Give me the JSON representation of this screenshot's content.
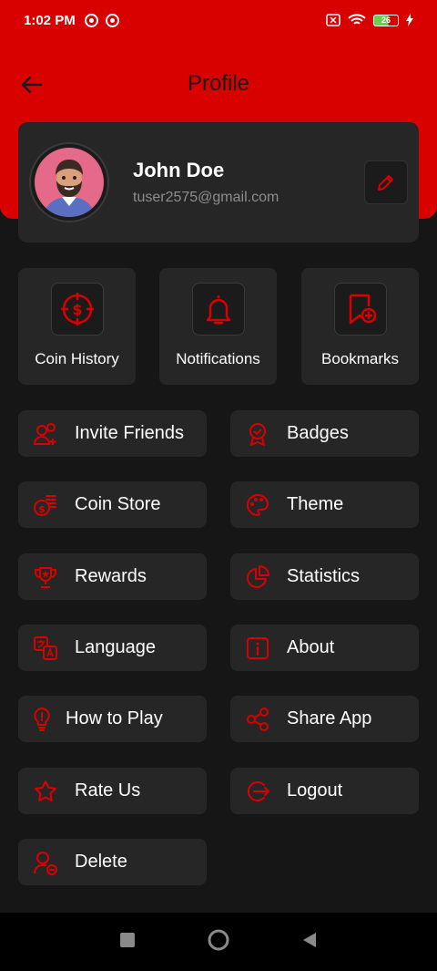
{
  "status_bar": {
    "time": "1:02 PM",
    "battery": "26"
  },
  "header": {
    "title": "Profile"
  },
  "profile": {
    "name": "John Doe",
    "email": "tuser2575@gmail.com"
  },
  "tiles": [
    {
      "label": "Coin History",
      "icon": "coin-history-icon"
    },
    {
      "label": "Notifications",
      "icon": "bell-icon"
    },
    {
      "label": "Bookmarks",
      "icon": "bookmark-add-icon"
    }
  ],
  "menu": [
    {
      "label": "Invite Friends",
      "icon": "invite-friends-icon"
    },
    {
      "label": "Badges",
      "icon": "badge-icon"
    },
    {
      "label": "Coin Store",
      "icon": "coin-store-icon"
    },
    {
      "label": "Theme",
      "icon": "palette-icon"
    },
    {
      "label": "Rewards",
      "icon": "trophy-icon"
    },
    {
      "label": "Statistics",
      "icon": "pie-chart-icon"
    },
    {
      "label": "Language",
      "icon": "translate-icon"
    },
    {
      "label": "About",
      "icon": "info-icon"
    },
    {
      "label": "How to Play",
      "icon": "lightbulb-icon"
    },
    {
      "label": "Share App",
      "icon": "share-icon"
    },
    {
      "label": "Rate Us",
      "icon": "star-icon"
    },
    {
      "label": "Logout",
      "icon": "logout-icon"
    },
    {
      "label": "Delete",
      "icon": "delete-user-icon"
    }
  ],
  "colors": {
    "accent": "#d90000",
    "background": "#161616",
    "card": "#262626"
  }
}
